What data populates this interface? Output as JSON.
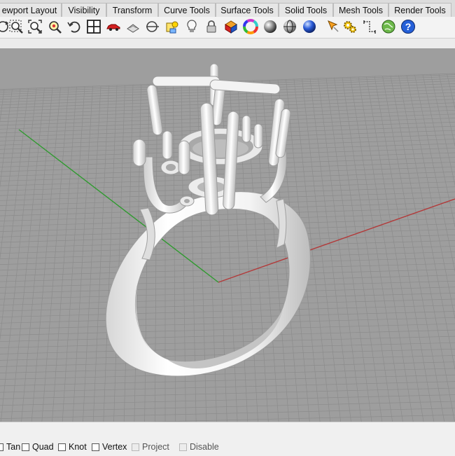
{
  "tabs": [
    {
      "label": "ewport Layout"
    },
    {
      "label": "Visibility"
    },
    {
      "label": "Transform"
    },
    {
      "label": "Curve Tools"
    },
    {
      "label": "Surface Tools"
    },
    {
      "label": "Solid Tools"
    },
    {
      "label": "Mesh Tools"
    },
    {
      "label": "Render Tools"
    }
  ],
  "toolbar_icons": [
    "rotate-view-icon",
    "zoom-window-icon",
    "zoom-extents-icon",
    "zoom-selected-icon",
    "undo-view-change-icon",
    "four-viewports-icon",
    "car-perspective-icon",
    "named-view-icon",
    "construction-plane-icon",
    "show-object-icon",
    "light-bulb-icon",
    "lock-icon",
    "render-icon",
    "color-wheel-icon",
    "shaded-sphere-icon",
    "rendered-sphere-icon",
    "blue-sphere-icon",
    "cursor-options-icon",
    "settings-gear-icon",
    "dimension-icon",
    "globe-icon",
    "help-icon"
  ],
  "osnap": [
    {
      "label": "Tan",
      "checked": false,
      "enabled": true
    },
    {
      "label": "Quad",
      "checked": false,
      "enabled": true
    },
    {
      "label": "Knot",
      "checked": false,
      "enabled": true
    },
    {
      "label": "Vertex",
      "checked": false,
      "enabled": true
    },
    {
      "label": "Project",
      "checked": false,
      "enabled": false
    },
    {
      "label": "Disable",
      "checked": false,
      "enabled": false
    }
  ],
  "colors": {
    "viewport_background": "#9e9e9e",
    "grid_line": "#8c8c8c",
    "x_axis": "#b23a3a",
    "y_axis": "#2f9a2f",
    "model": "#f2f2f2"
  }
}
